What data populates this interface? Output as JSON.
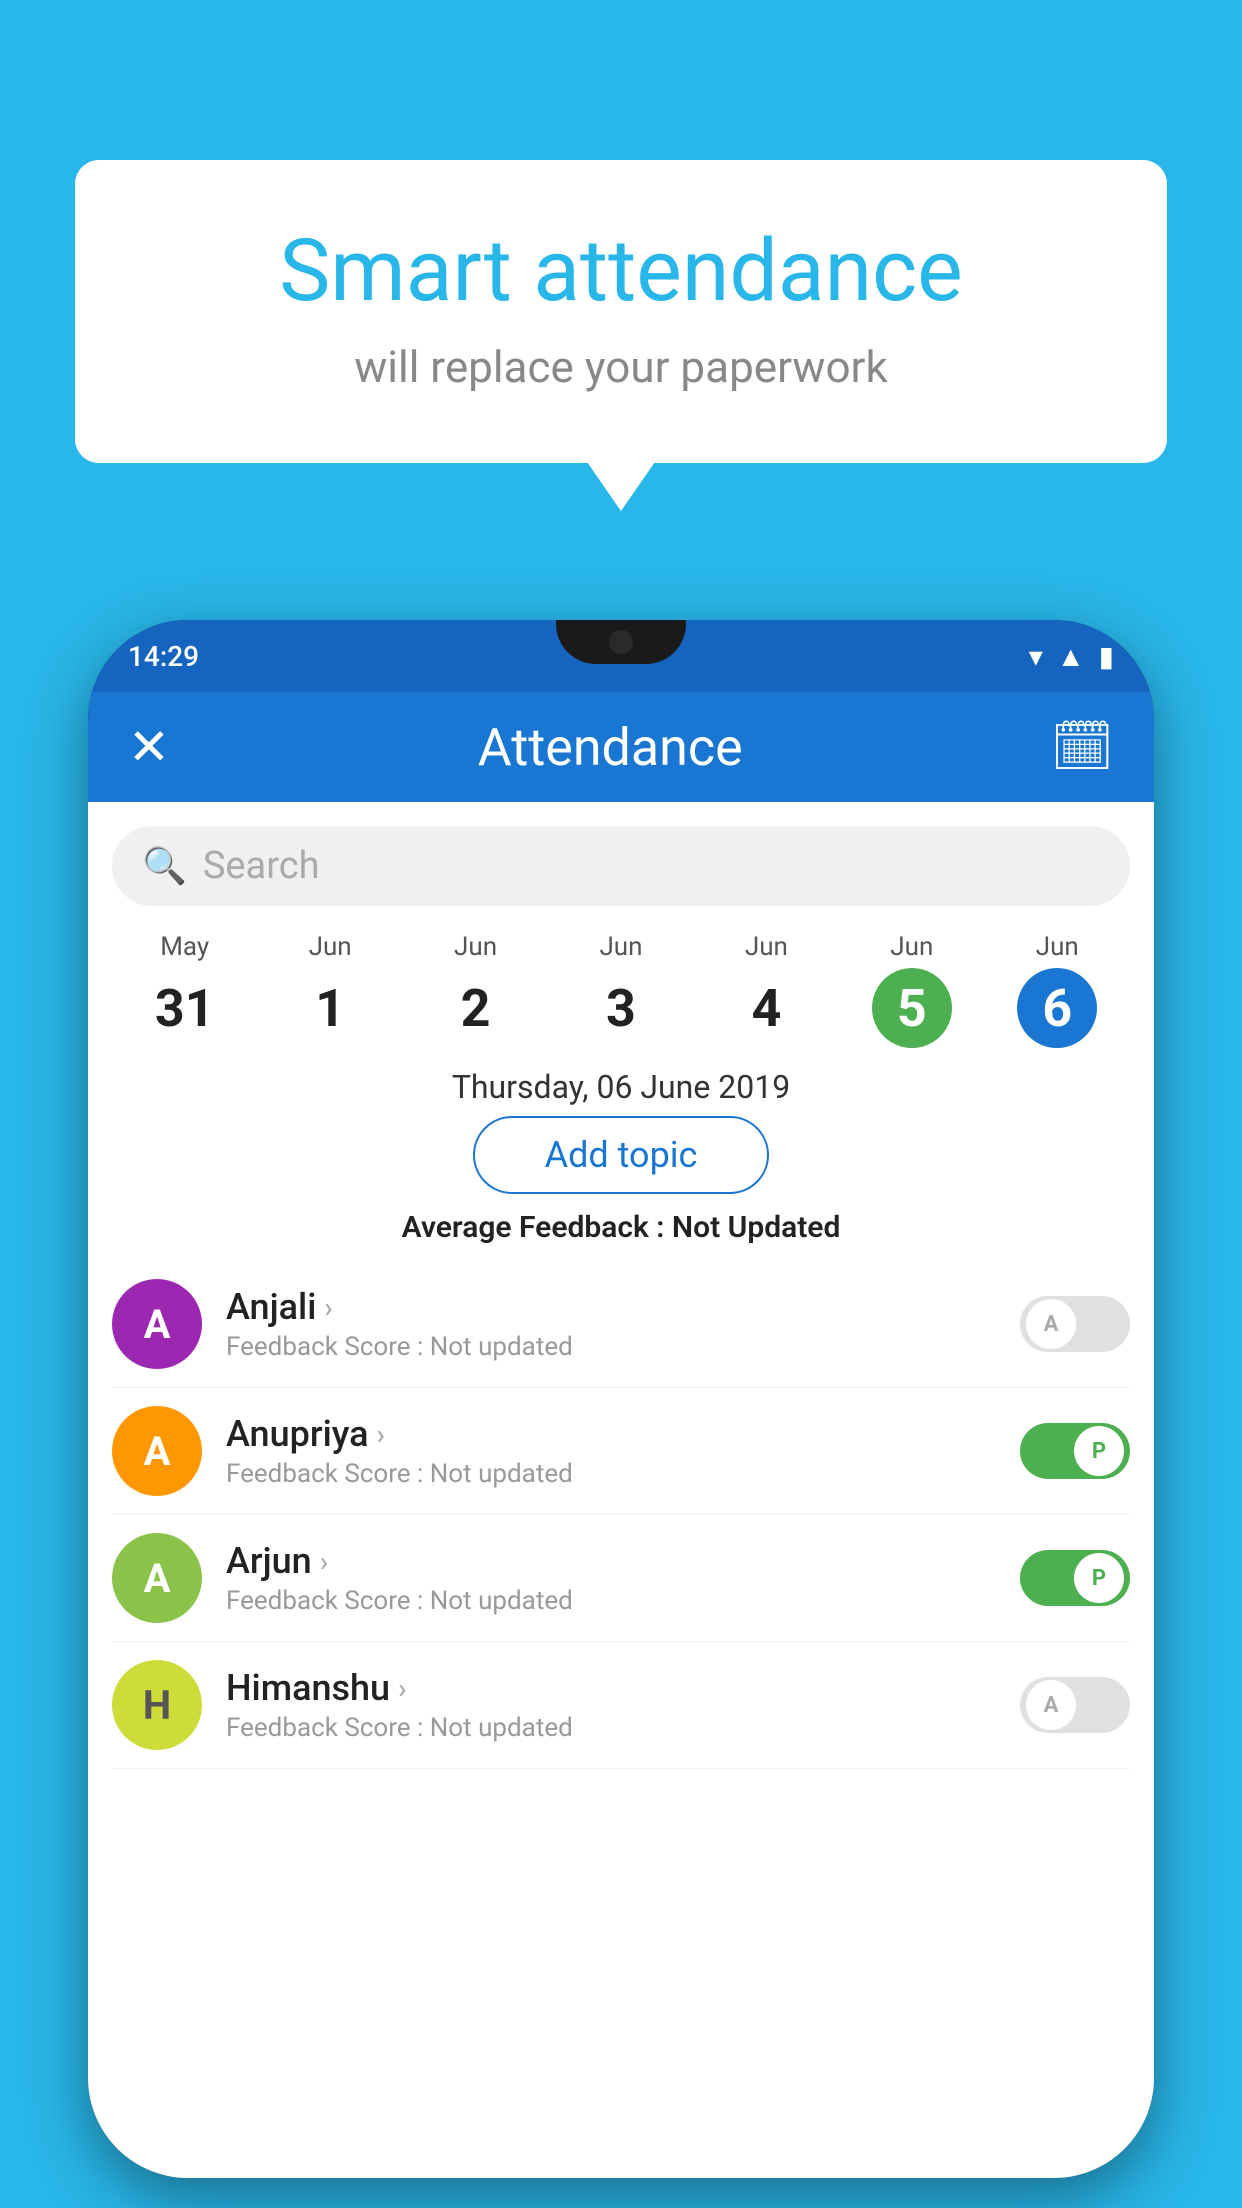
{
  "background_color": "#29B6E8",
  "speech_bubble": {
    "title": "Smart attendance",
    "subtitle": "will replace your paperwork"
  },
  "phone": {
    "status_bar": {
      "time": "14:29",
      "icons": [
        "wifi",
        "signal",
        "battery"
      ]
    },
    "app_bar": {
      "close_label": "✕",
      "title": "Attendance",
      "calendar_icon": "📅"
    },
    "search": {
      "placeholder": "Search"
    },
    "dates": [
      {
        "month": "May",
        "day": "31",
        "highlight": "none"
      },
      {
        "month": "Jun",
        "day": "1",
        "highlight": "none"
      },
      {
        "month": "Jun",
        "day": "2",
        "highlight": "none"
      },
      {
        "month": "Jun",
        "day": "3",
        "highlight": "none"
      },
      {
        "month": "Jun",
        "day": "4",
        "highlight": "none"
      },
      {
        "month": "Jun",
        "day": "5",
        "highlight": "green"
      },
      {
        "month": "Jun",
        "day": "6",
        "highlight": "blue"
      }
    ],
    "selected_date_label": "Thursday, 06 June 2019",
    "add_topic_label": "Add topic",
    "avg_feedback_label": "Average Feedback :",
    "avg_feedback_value": "Not Updated",
    "students": [
      {
        "name": "Anjali",
        "avatar_letter": "A",
        "avatar_color": "purple",
        "feedback_label": "Feedback Score :",
        "feedback_value": "Not updated",
        "toggle_state": "off",
        "toggle_letter": "A"
      },
      {
        "name": "Anupriya",
        "avatar_letter": "A",
        "avatar_color": "orange",
        "feedback_label": "Feedback Score :",
        "feedback_value": "Not updated",
        "toggle_state": "on",
        "toggle_letter": "P"
      },
      {
        "name": "Arjun",
        "avatar_letter": "A",
        "avatar_color": "light-green",
        "feedback_label": "Feedback Score :",
        "feedback_value": "Not updated",
        "toggle_state": "on",
        "toggle_letter": "P"
      },
      {
        "name": "Himanshu",
        "avatar_letter": "H",
        "avatar_color": "khaki",
        "feedback_label": "Feedback Score :",
        "feedback_value": "Not updated",
        "toggle_state": "off",
        "toggle_letter": "A"
      }
    ]
  }
}
